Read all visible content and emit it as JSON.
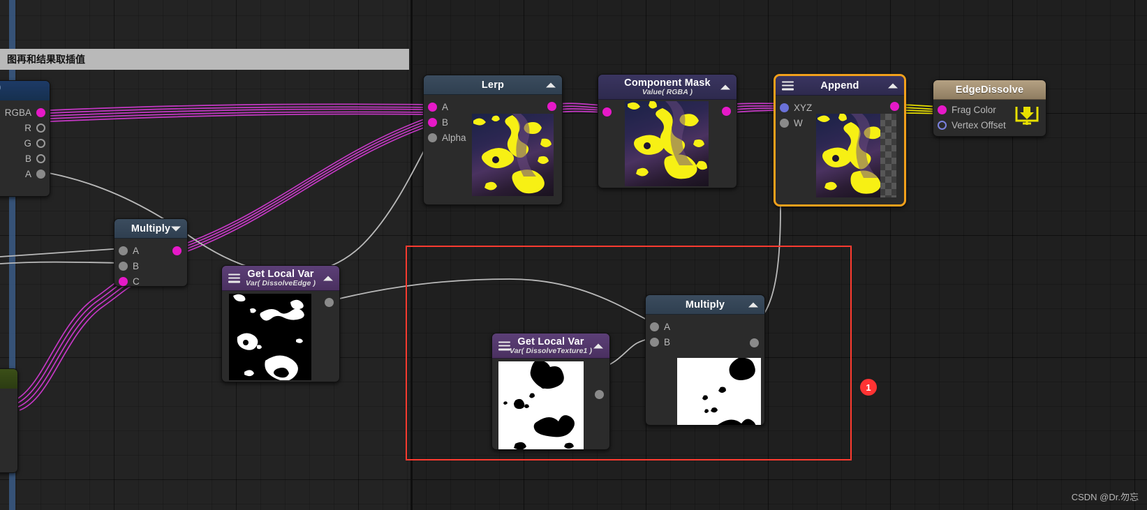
{
  "app": {
    "kind": "shader-node-graph-editor",
    "banner_text": "图再和结果取插值",
    "watermark": "CSDN @Dr.勿忘",
    "accent_selection": "#f2a01b",
    "annotation_color": "#ff3b30",
    "wire_colors": {
      "data": "#c438c4",
      "value": "#b9b9b9",
      "output": "#e8e000"
    }
  },
  "annotations": [
    {
      "name": "region-highlight",
      "badge": "1"
    }
  ],
  "nodes": [
    {
      "id": "texture-sample-left",
      "title": "",
      "subtitle": "",
      "header_style": "navy",
      "outputs": [
        {
          "label": "RGBA",
          "dot": "mag"
        },
        {
          "label": "R",
          "dot": "hollow-gray"
        },
        {
          "label": "G",
          "dot": "hollow-gray"
        },
        {
          "label": "B",
          "dot": "hollow-gray"
        },
        {
          "label": "A",
          "dot": "gray"
        }
      ]
    },
    {
      "id": "node-bottom-left",
      "title": "",
      "subtitle": "",
      "header_style": "green",
      "outputs": [
        {
          "label": "",
          "dot": "mag"
        },
        {
          "label": "",
          "dot": "hollow-gray"
        },
        {
          "label": "",
          "dot": "hollow-gray"
        },
        {
          "label": "",
          "dot": "hollow-gray"
        },
        {
          "label": "",
          "dot": "hollow-gray"
        }
      ]
    },
    {
      "id": "multiply-1",
      "title": "Multiply",
      "subtitle": "",
      "header_style": "blue",
      "caret": "down",
      "inputs": [
        {
          "label": "A",
          "dot": "gray"
        },
        {
          "label": "B",
          "dot": "gray"
        },
        {
          "label": "C",
          "dot": "mag"
        }
      ],
      "outputs": [
        {
          "label": "",
          "dot": "mag"
        }
      ]
    },
    {
      "id": "get-local-var-dissolve-edge",
      "title": "Get Local Var",
      "subtitle": "Var( DissolveEdge )",
      "header_style": "purple",
      "burger": true,
      "caret": "up",
      "outputs": [
        {
          "label": "",
          "dot": "gray"
        }
      ],
      "preview": "noise-black"
    },
    {
      "id": "lerp",
      "title": "Lerp",
      "subtitle": "",
      "header_style": "blue",
      "caret": "up",
      "inputs": [
        {
          "label": "A",
          "dot": "mag"
        },
        {
          "label": "B",
          "dot": "mag"
        },
        {
          "label": "Alpha",
          "dot": "gray"
        }
      ],
      "outputs": [
        {
          "label": "",
          "dot": "mag"
        }
      ],
      "preview": "anime"
    },
    {
      "id": "component-mask",
      "title": "Component Mask",
      "subtitle": "Value( RGBA )",
      "header_style": "purple-dark",
      "caret": "up",
      "inputs": [
        {
          "label": "",
          "dot": "mag"
        }
      ],
      "outputs": [
        {
          "label": "",
          "dot": "mag"
        }
      ],
      "preview": "anime"
    },
    {
      "id": "append",
      "title": "Append",
      "subtitle": "",
      "header_style": "purple-dark",
      "burger": true,
      "caret": "up",
      "selected": true,
      "inputs": [
        {
          "label": "XYZ",
          "dot": "blue"
        },
        {
          "label": "W",
          "dot": "gray"
        }
      ],
      "outputs": [
        {
          "label": "",
          "dot": "mag"
        }
      ],
      "preview": "anime-checker"
    },
    {
      "id": "edge-dissolve-master",
      "title": "EdgeDissolve",
      "subtitle": "",
      "header_style": "tan",
      "inputs": [
        {
          "label": "Frag Color",
          "dot": "mag"
        },
        {
          "label": "Vertex Offset",
          "dot": "hollow-blue"
        }
      ],
      "icon": "monitor-download-icon"
    },
    {
      "id": "get-local-var-dissolve-texture1",
      "title": "Get Local Var",
      "subtitle": "Var( DissolveTexture1 )",
      "header_style": "purple",
      "burger": true,
      "caret": "up",
      "outputs": [
        {
          "label": "",
          "dot": "gray"
        }
      ],
      "preview": "noise-white"
    },
    {
      "id": "multiply-2",
      "title": "Multiply",
      "subtitle": "",
      "header_style": "blue",
      "caret": "up",
      "inputs": [
        {
          "label": "A",
          "dot": "gray"
        },
        {
          "label": "B",
          "dot": "gray"
        }
      ],
      "outputs": [
        {
          "label": "",
          "dot": "gray"
        }
      ],
      "preview": "noise-white"
    }
  ]
}
